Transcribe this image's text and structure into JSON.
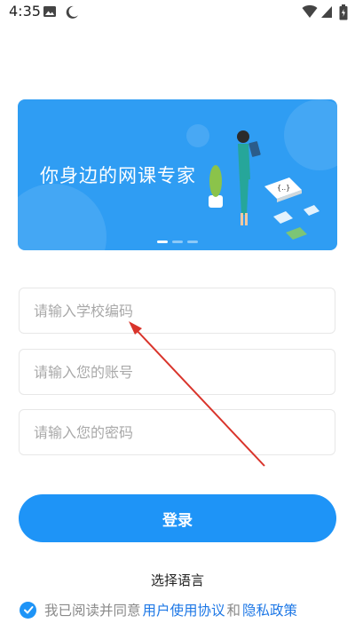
{
  "status_bar": {
    "time": "4:35",
    "icons": [
      "image-icon",
      "moon-icon",
      "wifi-icon",
      "signal-icon",
      "battery-icon"
    ]
  },
  "banner": {
    "headline": "你身边的网课专家",
    "background_color": "#2f9df3",
    "carousel_page": 1,
    "carousel_total": 3
  },
  "form": {
    "school_code_placeholder": "请输入学校编码",
    "account_placeholder": "请输入您的账号",
    "password_placeholder": "请输入您的密码"
  },
  "login_button": "登录",
  "language_label": "选择语言",
  "agreement": {
    "prefix": "我已阅读并同意",
    "user_agreement": "用户使用协议",
    "conjunction": "和",
    "privacy_policy": "隐私政策",
    "checked": true
  },
  "colors": {
    "primary": "#1e94f7",
    "link": "#1e78e6",
    "annotation_arrow": "#d9342b"
  }
}
